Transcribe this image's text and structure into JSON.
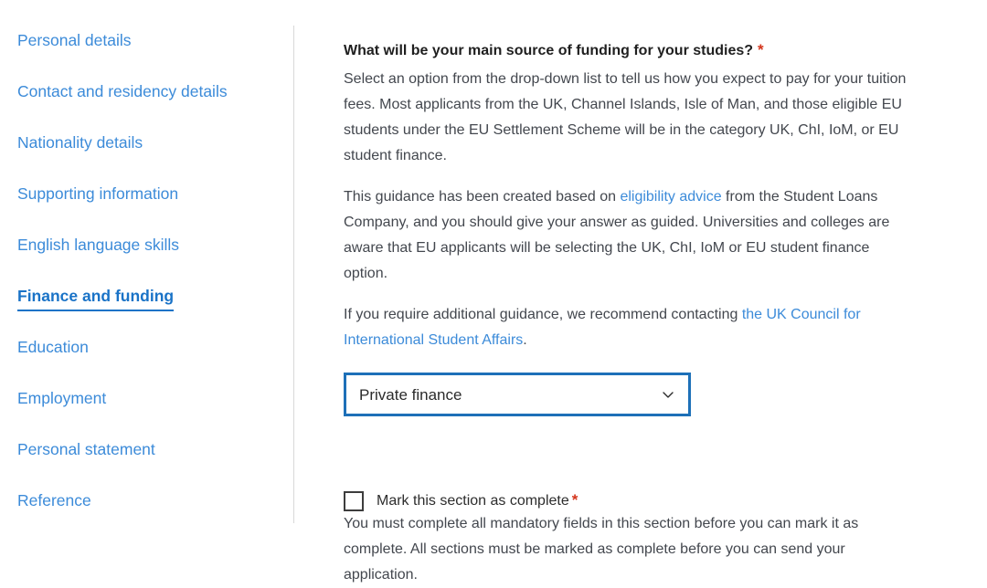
{
  "sidebar": {
    "items": [
      {
        "label": "Personal details",
        "active": false
      },
      {
        "label": "Contact and residency details",
        "active": false
      },
      {
        "label": "Nationality details",
        "active": false
      },
      {
        "label": "Supporting information",
        "active": false
      },
      {
        "label": "English language skills",
        "active": false
      },
      {
        "label": "Finance and funding",
        "active": true
      },
      {
        "label": "Education",
        "active": false
      },
      {
        "label": "Employment",
        "active": false
      },
      {
        "label": "Personal statement",
        "active": false
      },
      {
        "label": "Reference",
        "active": false
      }
    ]
  },
  "main": {
    "question": {
      "heading": "What will be your main source of funding for your studies?",
      "required_marker": "*"
    },
    "paragraph_1": "Select an option from the drop-down list to tell us how you expect to pay for your tuition fees. Most applicants from the UK, Channel Islands, Isle of Man, and those eligible EU students under the EU Settlement Scheme will be in the category UK, ChI, IoM, or EU student finance.",
    "paragraph_2": {
      "before_link": "This guidance has been created based on ",
      "link_text": "eligibility advice",
      "after_link": " from the Student Loans Company, and you should give your answer as guided. Universities and colleges are aware that EU applicants will be selecting the UK, ChI, IoM or EU student finance option."
    },
    "paragraph_3": {
      "before_link": "If you require additional guidance, we recommend contacting ",
      "link_text": "the UK Council for International Student Affairs",
      "after_link": "."
    },
    "funding_select": {
      "value": "Private finance",
      "icon": "chevron-down-icon",
      "options": [
        "Private finance"
      ]
    },
    "completion": {
      "checkbox_label": "Mark this section as complete",
      "required_marker": "*",
      "checked": false,
      "note": "You must complete all mandatory fields in this section before you can mark it as complete. All sections must be marked as complete before you can send your application."
    }
  },
  "colors": {
    "link_blue": "#3c8bd9",
    "active_blue": "#1a73c7",
    "select_border_blue": "#1d70b8",
    "required_red": "#d4351c",
    "body_text": "#43474e",
    "heading_text": "#1f1f1f",
    "divider": "#d8d8d8"
  }
}
